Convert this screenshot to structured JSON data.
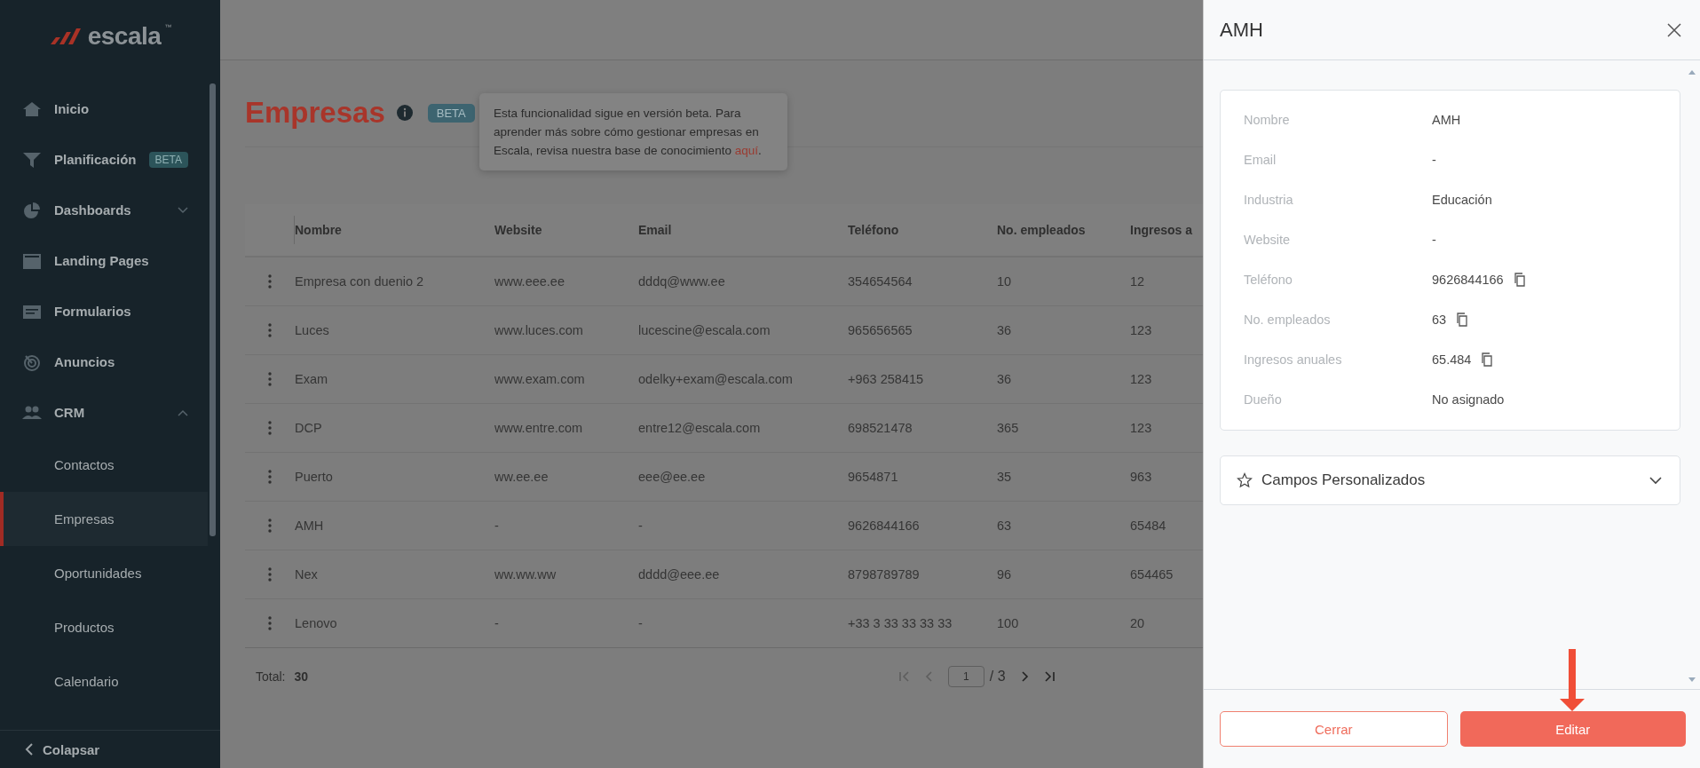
{
  "sidebar": {
    "logo": "escala",
    "trademark": "™",
    "items": [
      {
        "label": "Inicio"
      },
      {
        "label": "Planificación",
        "badge": "BETA"
      },
      {
        "label": "Dashboards",
        "expanded": false
      },
      {
        "label": "Landing Pages"
      },
      {
        "label": "Formularios"
      },
      {
        "label": "Anuncios"
      },
      {
        "label": "CRM",
        "expanded": true,
        "children": [
          {
            "label": "Contactos",
            "selected": false
          },
          {
            "label": "Empresas",
            "selected": true
          },
          {
            "label": "Oportunidades",
            "selected": false
          },
          {
            "label": "Productos",
            "selected": false
          },
          {
            "label": "Calendario",
            "selected": false
          }
        ]
      }
    ],
    "collapse": "Colapsar"
  },
  "page": {
    "title": "Empresas",
    "badge": "BETA",
    "tooltip": {
      "text": "Esta funcionalidad sigue en versión beta. Para aprender más sobre cómo gestionar empresas en Escala, revisa nuestra base de conocimiento ",
      "link": "aquí",
      "end": "."
    }
  },
  "table": {
    "columns": [
      "Nombre",
      "Website",
      "Email",
      "Teléfono",
      "No. empleados",
      "Ingresos a"
    ],
    "rows": [
      [
        "Empresa con duenio 2",
        "www.eee.ee",
        "dddq@www.ee",
        "354654564",
        "10",
        "12"
      ],
      [
        "Luces",
        "www.luces.com",
        "lucescine@escala.com",
        "965656565",
        "36",
        "123"
      ],
      [
        "Exam",
        "www.exam.com",
        "odelky+exam@escala.com",
        "+963 258415",
        "36",
        "123"
      ],
      [
        "DCP",
        "www.entre.com",
        "entre12@escala.com",
        "698521478",
        "365",
        "123"
      ],
      [
        "Puerto",
        "ww.ee.ee",
        "eee@ee.ee",
        "9654871",
        "35",
        "963"
      ],
      [
        "AMH",
        "-",
        "-",
        "9626844166",
        "63",
        "65484"
      ],
      [
        "Nex",
        "ww.ww.ww",
        "dddd@eee.ee",
        "8798789789",
        "96",
        "654465"
      ],
      [
        "Lenovo",
        "-",
        "-",
        "+33 3 33 33 33 33",
        "100",
        "20"
      ]
    ]
  },
  "pagination": {
    "total_label": "Total:",
    "total": "30",
    "page": "1",
    "of": "/ 3",
    "buttons": [
      {
        "kind": "first",
        "disabled": true
      },
      {
        "kind": "prev",
        "disabled": true
      },
      {
        "kind": "next",
        "disabled": false
      },
      {
        "kind": "last",
        "disabled": false
      }
    ]
  },
  "panel": {
    "title": "AMH",
    "fields": [
      {
        "label": "Nombre",
        "value": "AMH",
        "copyable": false
      },
      {
        "label": "Email",
        "value": "-",
        "copyable": false
      },
      {
        "label": "Industria",
        "value": "Educación",
        "copyable": false
      },
      {
        "label": "Website",
        "value": "-",
        "copyable": false
      },
      {
        "label": "Teléfono",
        "value": "9626844166",
        "copyable": true
      },
      {
        "label": "No. empleados",
        "value": "63",
        "copyable": true
      },
      {
        "label": "Ingresos anuales",
        "value": "65.484",
        "copyable": true
      },
      {
        "label": "Dueño",
        "value": "No asignado",
        "copyable": false
      }
    ],
    "custom_fields": {
      "label": "Campos Personalizados",
      "expanded": false
    },
    "buttons": [
      "Cerrar",
      "Editar"
    ]
  }
}
